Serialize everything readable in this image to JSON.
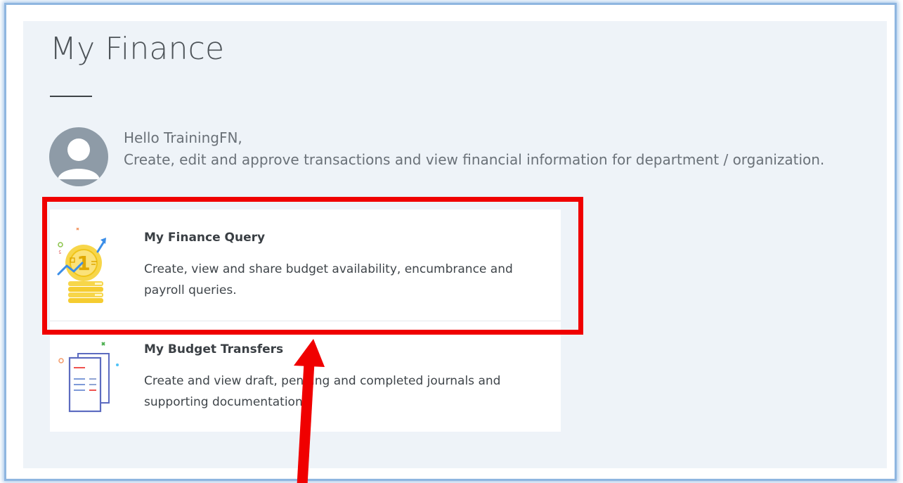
{
  "page": {
    "title": "My Finance"
  },
  "user": {
    "greeting": "Hello TrainingFN,",
    "description": "Create, edit and approve transactions and view financial information for department / organization.",
    "avatar_icon": "user-avatar-icon"
  },
  "cards": [
    {
      "title": "My Finance Query",
      "description": "Create, view and share budget availability, encumbrance and payroll queries.",
      "icon": "coin-chart-icon"
    },
    {
      "title": "My Budget Transfers",
      "description": "Create and view draft, pending and completed journals and supporting documentation.",
      "icon": "documents-icon"
    }
  ],
  "annotation": {
    "highlight_color": "#f00000",
    "arrow_color": "#f00000"
  },
  "colors": {
    "panel_background": "#eef3f8",
    "card_background": "#ffffff",
    "frame_border": "#8fb6e0"
  }
}
